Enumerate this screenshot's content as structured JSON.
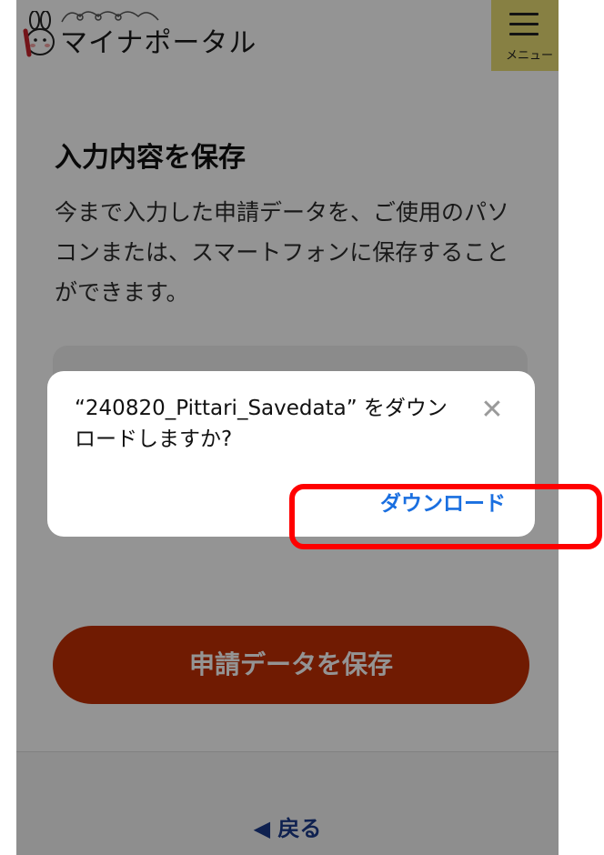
{
  "header": {
    "logo_text": "マイナポータル",
    "menu_label": "メニュー"
  },
  "page": {
    "title": "入力内容を保存",
    "description": "今まで入力した申請データを、ご使用のパソコンまたは、スマートフォンに保存することができます。",
    "save_button_label": "申請データを保存",
    "back_link": "◀ 戻る"
  },
  "dialog": {
    "message": "“240820_Pittari_Savedata” をダウンロードしますか?",
    "close_icon": "close-icon",
    "action_label": "ダウンロード"
  },
  "colors": {
    "menu_bg": "#e9dc74",
    "save_button": "#c22f05",
    "link": "#1a6fe0",
    "highlight": "#ff0000"
  }
}
